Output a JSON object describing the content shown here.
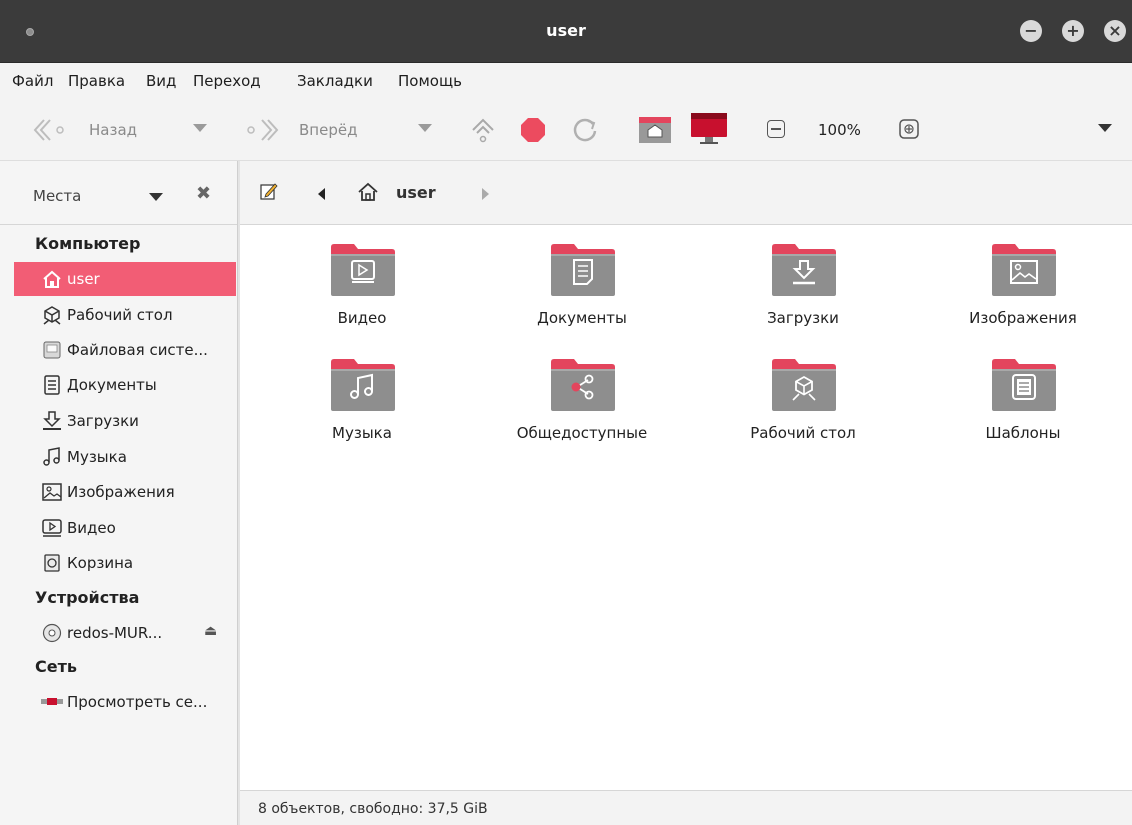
{
  "window": {
    "title": "user"
  },
  "menu": [
    "Файл",
    "Правка",
    "Вид",
    "Переход",
    "Закладки",
    "Помощь"
  ],
  "toolbar": {
    "back_label": "Назад",
    "forward_label": "Вперёд",
    "zoom": "100%"
  },
  "sidebar": {
    "header_label": "Места",
    "sections": {
      "computer": "Компьютер",
      "devices": "Устройства",
      "network": "Сеть"
    },
    "computer_items": [
      {
        "label": "user",
        "icon": "home-icon"
      },
      {
        "label": "Рабочий стол",
        "icon": "desktop-icon"
      },
      {
        "label": "Файловая систе...",
        "icon": "filesystem-icon"
      },
      {
        "label": "Документы",
        "icon": "documents-icon"
      },
      {
        "label": "Загрузки",
        "icon": "downloads-icon"
      },
      {
        "label": "Музыка",
        "icon": "music-icon"
      },
      {
        "label": "Изображения",
        "icon": "pictures-icon"
      },
      {
        "label": "Видео",
        "icon": "video-icon"
      },
      {
        "label": "Корзина",
        "icon": "trash-icon"
      }
    ],
    "device_items": [
      {
        "label": "redos-MUR...",
        "icon": "disc-icon"
      }
    ],
    "network_items": [
      {
        "label": "Просмотреть се...",
        "icon": "network-icon"
      }
    ]
  },
  "pathbar": {
    "current": "user"
  },
  "files": [
    {
      "label": "Видео",
      "icon": "video-folder-icon"
    },
    {
      "label": "Документы",
      "icon": "documents-folder-icon"
    },
    {
      "label": "Загрузки",
      "icon": "downloads-folder-icon"
    },
    {
      "label": "Изображения",
      "icon": "pictures-folder-icon"
    },
    {
      "label": "Музыка",
      "icon": "music-folder-icon"
    },
    {
      "label": "Общедоступные",
      "icon": "public-folder-icon"
    },
    {
      "label": "Рабочий стол",
      "icon": "desktop-folder-icon"
    },
    {
      "label": "Шаблоны",
      "icon": "templates-folder-icon"
    }
  ],
  "status": {
    "text": "8 объектов, свободно: 37,5 GiB"
  },
  "colors": {
    "accent": "#f25d75",
    "folder_tab": "#e3455d",
    "folder_body": "#8e8e8e",
    "titlebar": "#3b3b3b"
  }
}
